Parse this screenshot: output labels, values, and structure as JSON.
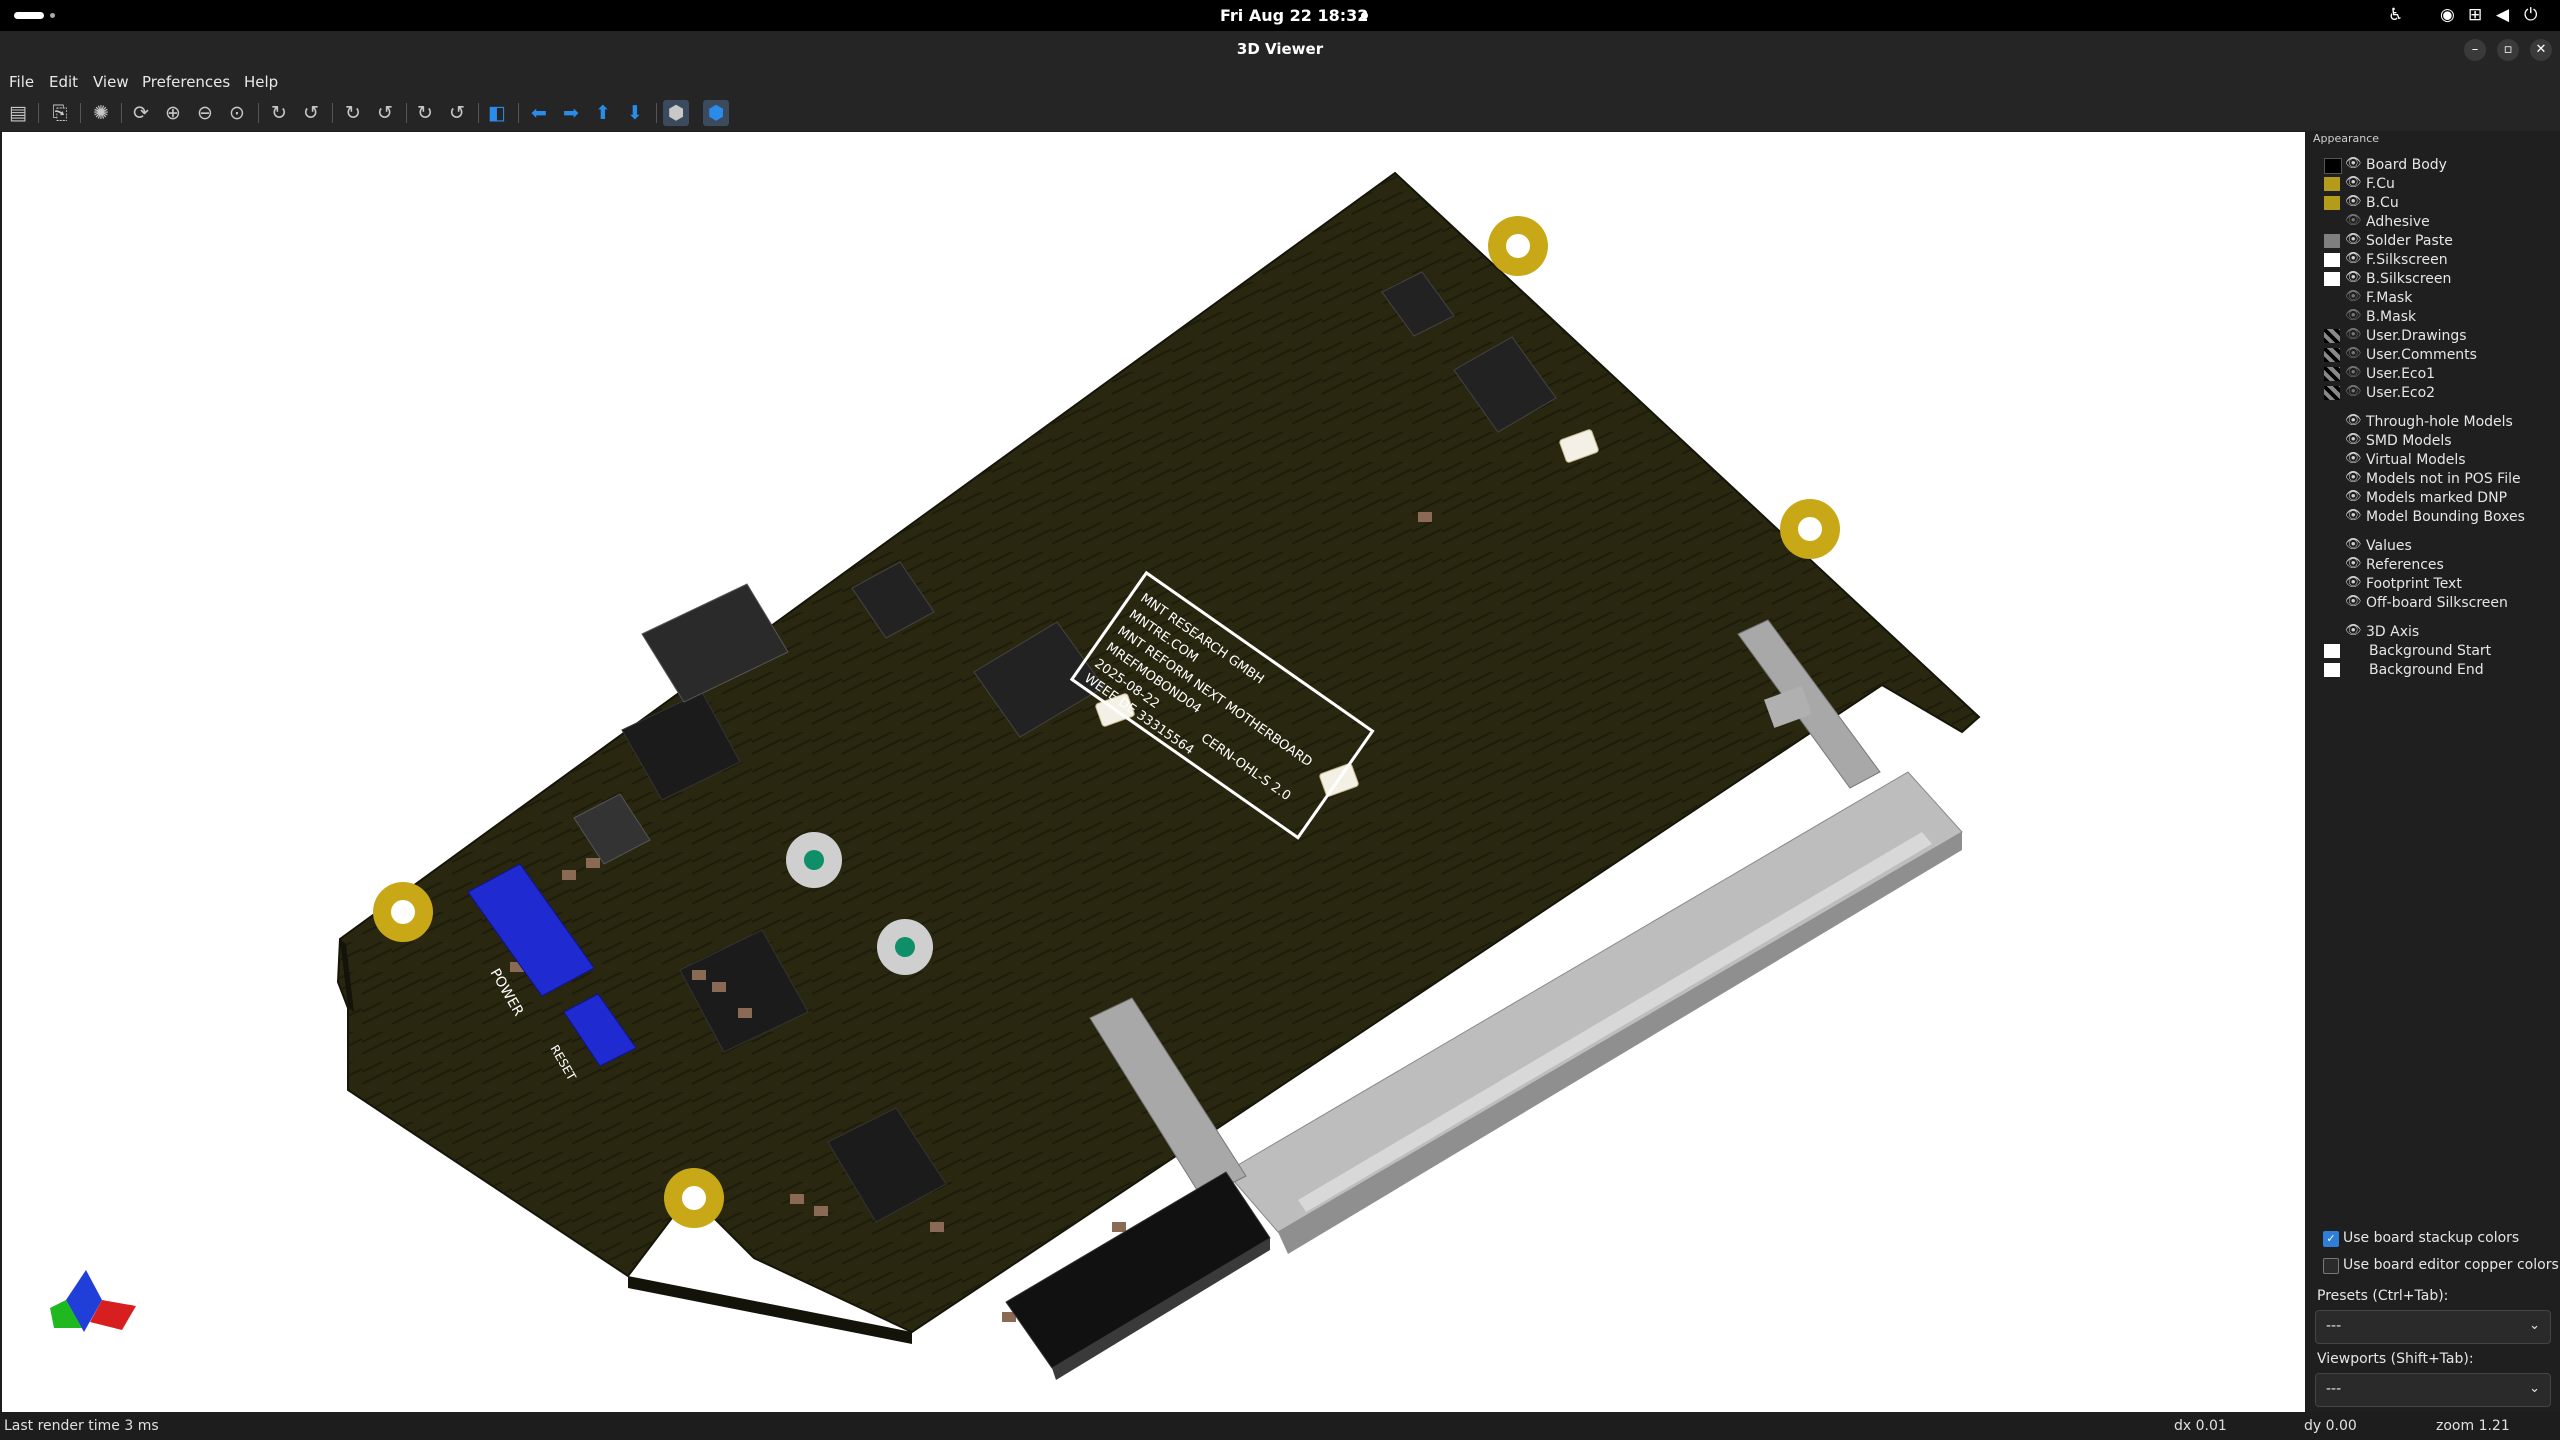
{
  "system": {
    "clock": "Fri Aug 22  18:32"
  },
  "window": {
    "title": "3D Viewer"
  },
  "menu": [
    "File",
    "Edit",
    "View",
    "Preferences",
    "Help"
  ],
  "board": {
    "silkscreen_lines": [
      "MNT RESEARCH GMBH",
      "MNTRE.COM",
      "MNT REFORM NEXT MOTHERBOARD",
      "MREFMOBOND04",
      "2025-08-22",
      "CERN-OHL-S 2.0",
      "WEEE DE 33315564"
    ],
    "labels": {
      "power": "POWER",
      "reset": "RESET"
    },
    "colors": {
      "board": "#2a2710",
      "gold": "#c9a818",
      "connector": "#bdbdbd",
      "button": "#1f2bd0",
      "chip": "#1b1b1b"
    }
  },
  "appearance": {
    "header": "Appearance",
    "layers": [
      {
        "name": "Board Body",
        "color": "#000000",
        "eye": true
      },
      {
        "name": "F.Cu",
        "color": "#b59b1a",
        "eye": true
      },
      {
        "name": "B.Cu",
        "color": "#b59b1a",
        "eye": true
      },
      {
        "name": "Adhesive",
        "color": "",
        "eye": false
      },
      {
        "name": "Solder Paste",
        "color": "#7f7f7f",
        "eye": true
      },
      {
        "name": "F.Silkscreen",
        "color": "#ffffff",
        "eye": true
      },
      {
        "name": "B.Silkscreen",
        "color": "#ffffff",
        "eye": true
      },
      {
        "name": "F.Mask",
        "color": "",
        "eye": false
      },
      {
        "name": "B.Mask",
        "color": "",
        "eye": false
      },
      {
        "name": "User.Drawings",
        "color": "checker",
        "eye": false
      },
      {
        "name": "User.Comments",
        "color": "checker",
        "eye": false
      },
      {
        "name": "User.Eco1",
        "color": "checker",
        "eye": false
      },
      {
        "name": "User.Eco2",
        "color": "checker",
        "eye": false
      }
    ],
    "models": [
      "Through-hole Models",
      "SMD Models",
      "Virtual Models",
      "Models not in POS File",
      "Models marked DNP",
      "Model Bounding Boxes"
    ],
    "texts": [
      "Values",
      "References",
      "Footprint Text",
      "Off-board Silkscreen"
    ],
    "axis": "3D Axis",
    "background": [
      "Background Start",
      "Background End"
    ],
    "use_stackup": "Use board stackup colors",
    "use_editor": "Use board editor copper colors",
    "presets_label": "Presets (Ctrl+Tab):",
    "presets_value": "---",
    "viewports_label": "Viewports (Shift+Tab):",
    "viewports_value": "---"
  },
  "status": {
    "render": "Last render time 3 ms",
    "dx": "dx 0.01",
    "dy": "dy 0.00",
    "zoom": "zoom 1.21"
  }
}
